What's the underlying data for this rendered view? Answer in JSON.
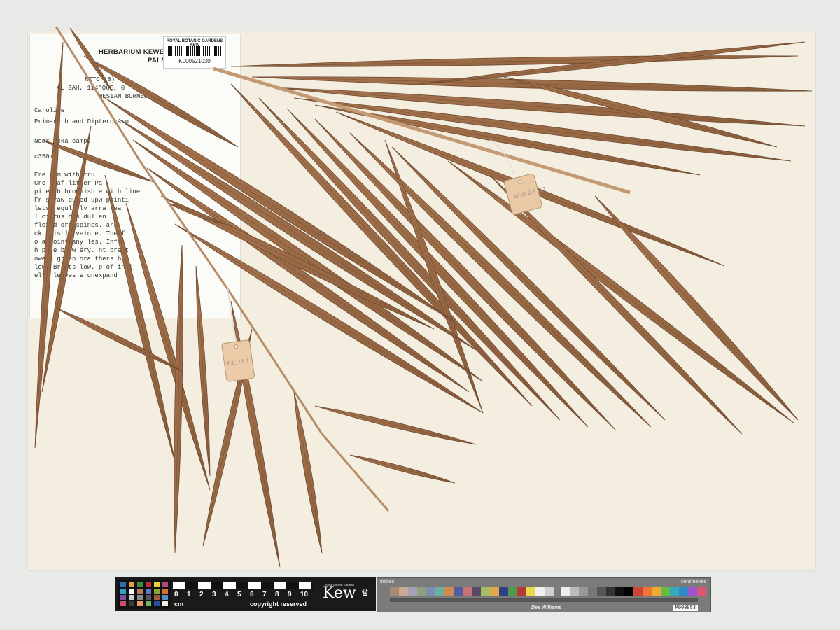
{
  "label": {
    "heading": "HERBARIUM KEWENSE",
    "heading2": "PALM",
    "lines": [
      "RITO (8)",
      "AL    GAH, 114°06E, 0",
      "NESIAN BORNEO",
      "Caroline",
      "Primary h   and Dipterocarp",
      "Near Reka      camp.",
      "c350m.",
      "Ere    c2m with tru",
      "Cre    leaf litter   Pa",
      "pi    e, b  brownish    e with line",
      "Fr   straw oured upw   pointi",
      "   lets regularly arra     lea",
      "   l cirrus  his  dul    en",
      "  flexed ora  spines.      ark",
      "  ck bristle   vein     e. The f",
      "  o a point    any       les. Infl",
      " h pale brow     ery.     nt bract",
      " owers green      ora    thers bri",
      "  low. Bracts      low.    p of infl",
      "  elve leaves        e unexpand"
    ]
  },
  "barcode": {
    "org": "ROYAL BOTANIC GARDENS KEW",
    "number": "K000521030"
  },
  "tags": {
    "tag1": "MHG 2.? 121",
    "tag2": "FJL 75 ?"
  },
  "scale_bar": {
    "numbers": [
      "0",
      "1",
      "2",
      "3",
      "4",
      "5",
      "6",
      "7",
      "8",
      "9",
      "10"
    ],
    "unit": "cm",
    "copyright": "copyright reserved",
    "logo": "Kew",
    "logo_sub": "Royal Botanic Gardens"
  },
  "color_card": {
    "left_label": "inches",
    "right_label": "centimetres",
    "brand": "Dee Williams",
    "id": "M000953"
  },
  "colors": {
    "sheet": "#f3eee0",
    "leaf": "#9a6a47",
    "leaf_dark": "#6e4a31",
    "rachis": "#c49a74"
  }
}
